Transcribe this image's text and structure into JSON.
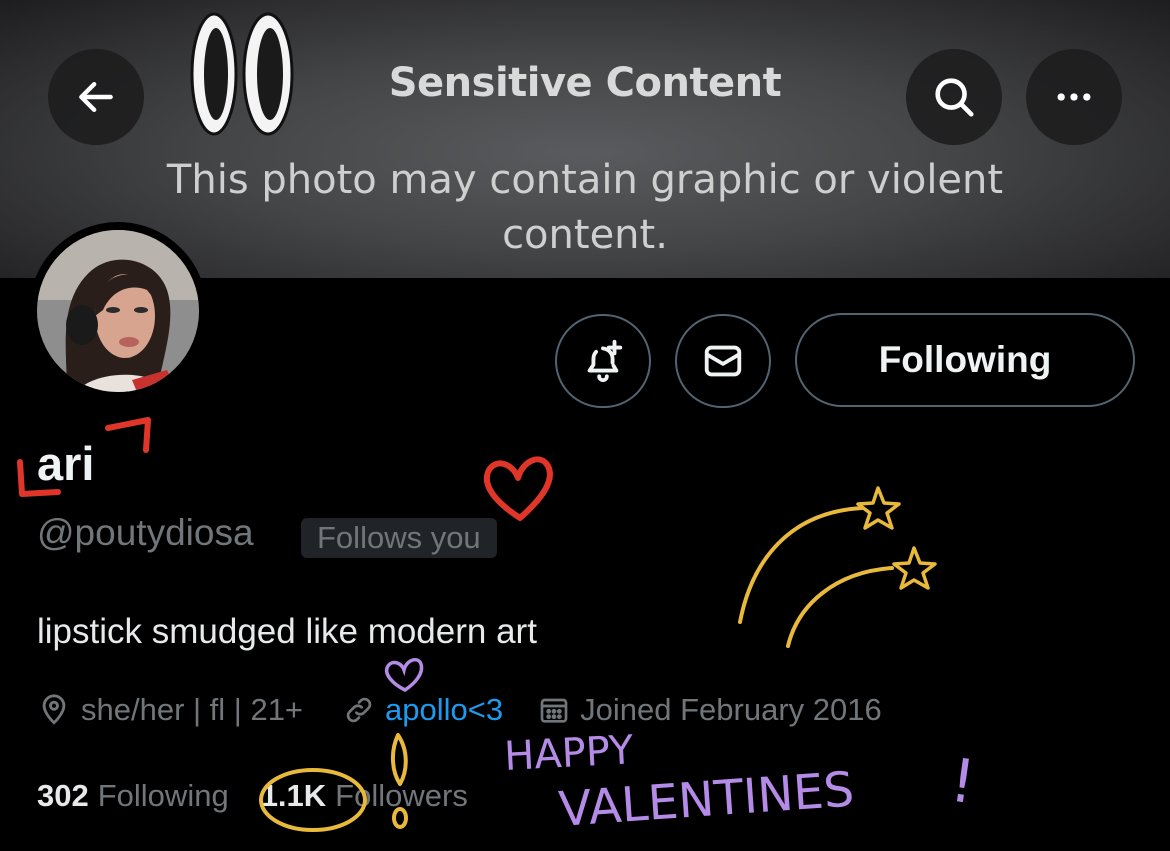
{
  "banner": {
    "title": "Sensitive Content",
    "message": "This photo may contain graphic or violent content."
  },
  "header": {
    "back_icon": "arrow-left-icon",
    "search_icon": "search-icon",
    "more_icon": "more-horizontal-icon"
  },
  "actions": {
    "notify_icon": "bell-plus-icon",
    "message_icon": "envelope-icon",
    "following_label": "Following"
  },
  "profile": {
    "display_name": "ari",
    "handle": "@poutydiosa",
    "follows_you": "Follows you",
    "bio": "lipstick smudged like modern art",
    "location": "she/her | fl | 21+",
    "link": "apollo<3",
    "joined": "Joined February 2016",
    "following_count": "302",
    "following_label": "Following",
    "followers_count": "1.1K",
    "followers_label": "Followers"
  },
  "doodles": {
    "text_line1": "HAPPY",
    "text_line2": "VALENTINES",
    "exclamation": "!"
  },
  "colors": {
    "background": "#000000",
    "link": "#1d9bf0",
    "muted": "#71767b",
    "doodle_red": "#e0362a",
    "doodle_yellow": "#e8b93a",
    "doodle_purple": "#b48be6"
  }
}
